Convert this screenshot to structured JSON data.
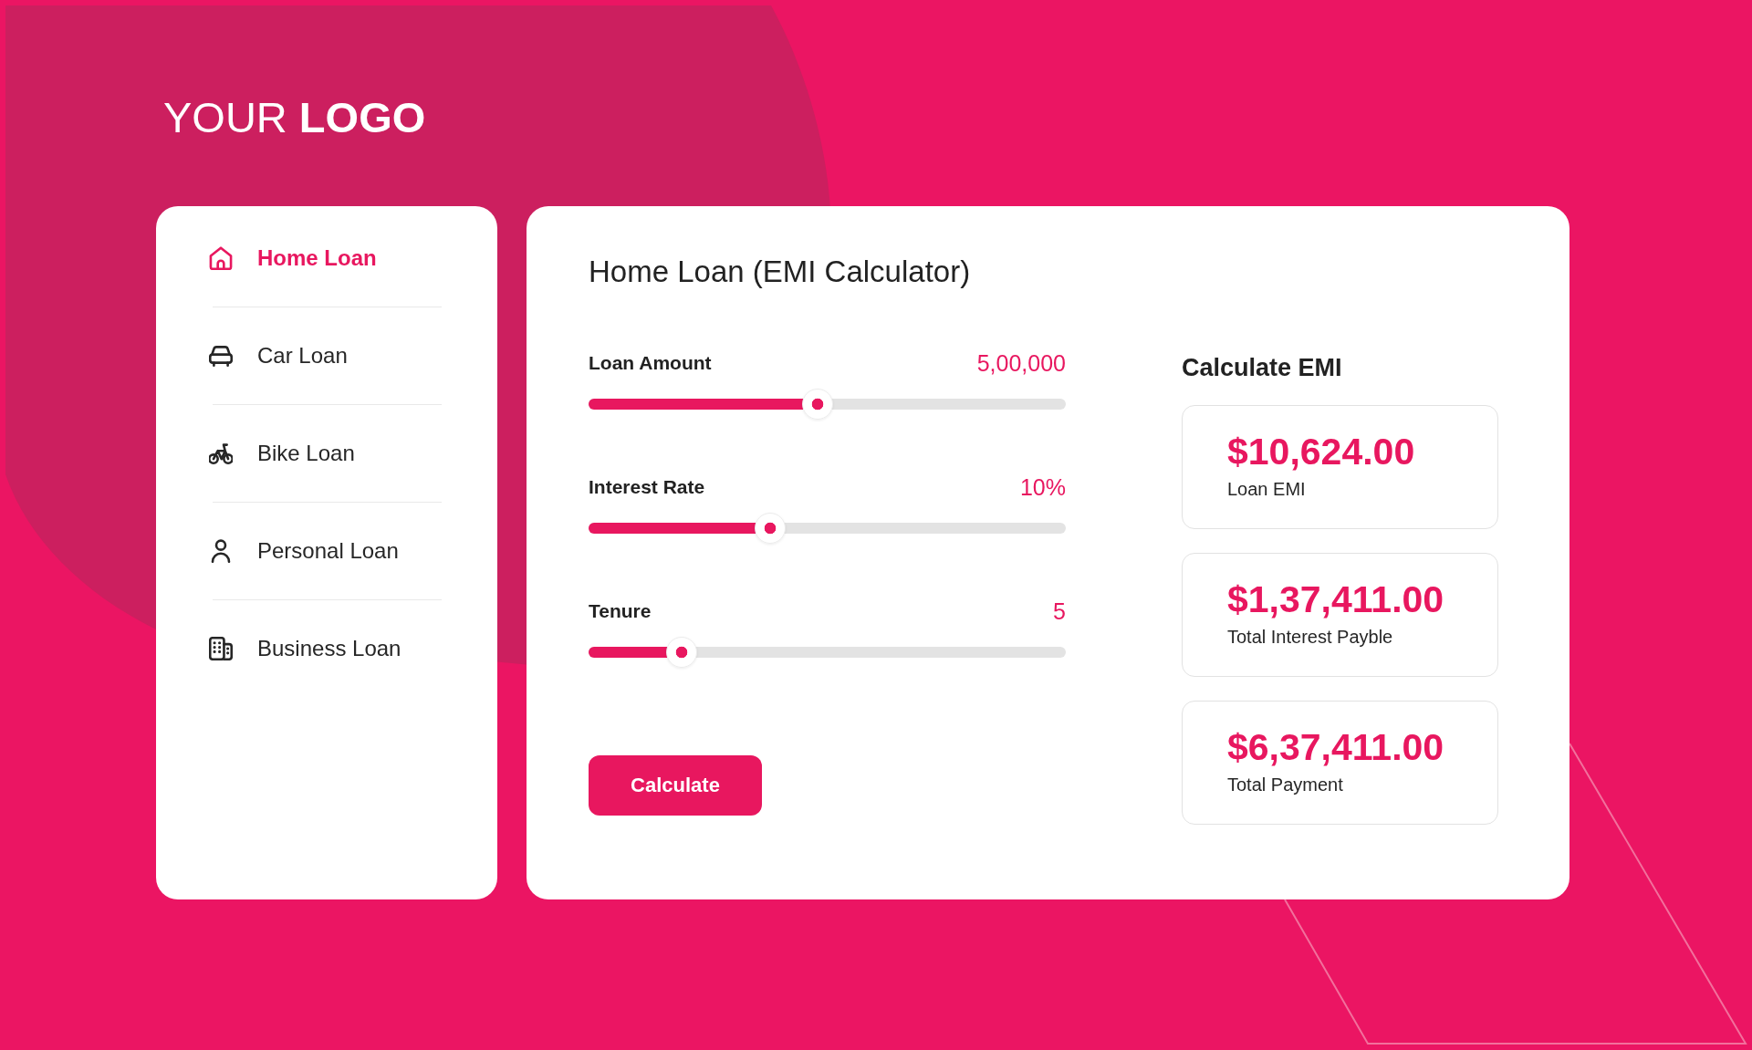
{
  "logo": "YOUR **LOGO**",
  "sidebar": {
    "items": [
      {
        "label": "Home Loan",
        "kind": "home",
        "selected": true
      },
      {
        "label": "Car Loan",
        "kind": "car",
        "selected": false
      },
      {
        "label": "Bike Loan",
        "kind": "bike",
        "selected": false
      },
      {
        "label": "Personal Loan",
        "kind": "personal",
        "selected": false
      },
      {
        "label": "Business Loan",
        "kind": "business",
        "selected": false
      }
    ]
  },
  "calculator": {
    "title": "Home Loan (EMI Calculator)",
    "sliders": [
      {
        "label": "Loan Amount",
        "reading": "5,00,000",
        "level": 0.48
      },
      {
        "label": "Interest Rate",
        "reading": "10%",
        "level": 0.38
      },
      {
        "label": "Tenure",
        "reading": "5",
        "level": 0.195
      }
    ],
    "button": "Calculate"
  },
  "results": {
    "title": "Calculate EMI",
    "cards": [
      {
        "amount": "$10,624.00",
        "label": "Loan EMI"
      },
      {
        "amount": "$1,37,411.00",
        "label": "Total Interest Payble"
      },
      {
        "amount": "$6,37,411.00",
        "label": "Total Payment"
      }
    ]
  }
}
